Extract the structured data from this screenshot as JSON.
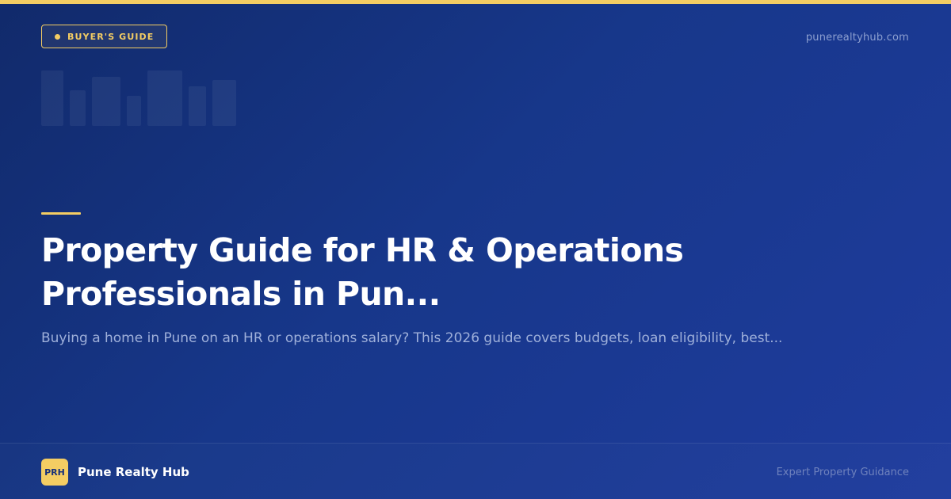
{
  "badge": {
    "label": "BUYER'S GUIDE"
  },
  "site": {
    "url": "punerealtyhub.com"
  },
  "article": {
    "title": "Property Guide for HR & Operations Professionals in Pun...",
    "description": "Buying a home in Pune on an HR or operations salary? This 2026 guide covers budgets, loan eligibility, best..."
  },
  "brand": {
    "logo_text": "PRH",
    "name": "Pune Realty Hub",
    "tagline": "Expert Property Guidance"
  },
  "colors": {
    "background": "#17378a",
    "accent": "#f4cd63",
    "text": "#ffffff",
    "muted_text": "#9fb0da"
  },
  "icons": {
    "badge_dot": "dot-icon",
    "skyline": "city-skyline-icon"
  }
}
